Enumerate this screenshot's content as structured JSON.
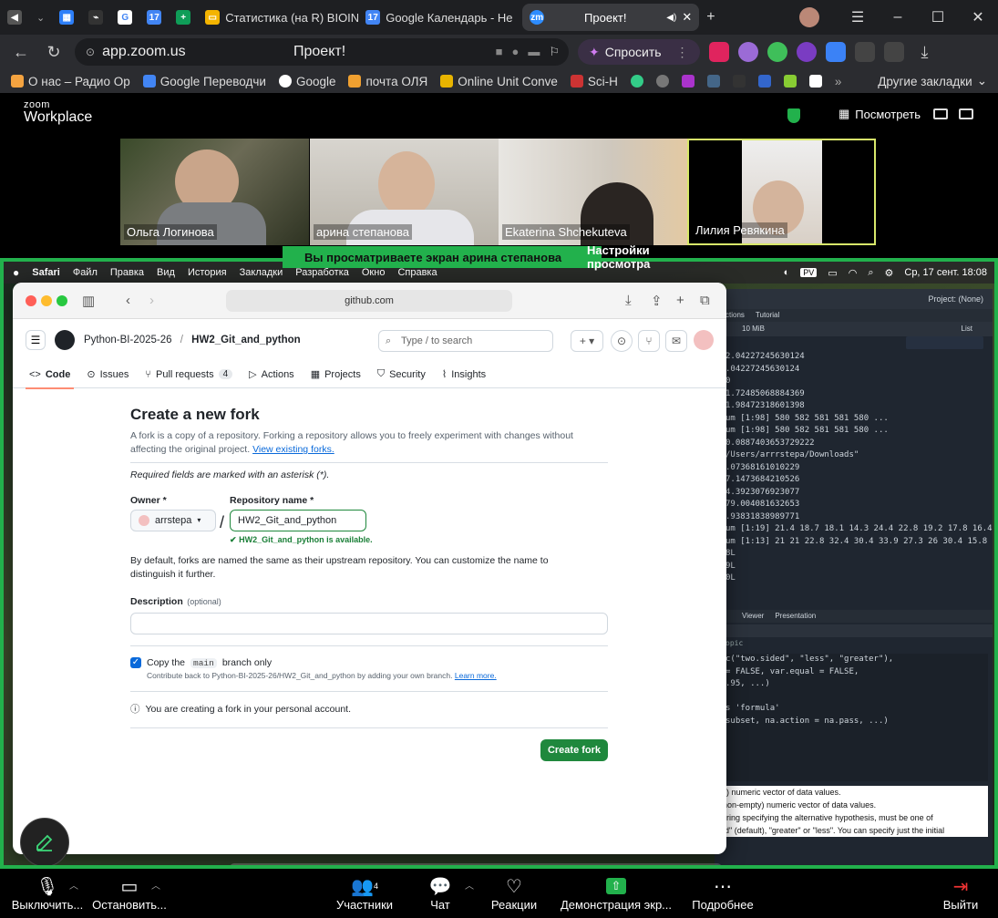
{
  "browser": {
    "tabs": [
      {
        "label": "",
        "icon": "speaker-icon"
      },
      {
        "label": "",
        "icon": "chevron-down-icon"
      },
      {
        "label": "",
        "icon": "grid-icon"
      },
      {
        "label": "",
        "icon": "link-icon"
      },
      {
        "label": "",
        "icon": "google-icon"
      },
      {
        "label": "",
        "icon": "calendar-icon"
      },
      {
        "label": "",
        "icon": "sheets-icon"
      },
      {
        "label": "Статистика (на R) BIOIN",
        "icon": "slides-icon"
      },
      {
        "label": "Google Календарь - Не",
        "icon": "calendar-icon"
      },
      {
        "label": "Проект!",
        "icon": "zoom-icon"
      }
    ],
    "url": "app.zoom.us",
    "page_title": "Проект!",
    "ask_button": "Спросить",
    "bookmarks": [
      "О нас – Радио Ор",
      "Google Переводчи",
      "Google",
      "почта ОЛЯ",
      "Online Unit Conve",
      "Sci-H"
    ],
    "other_bookmarks": "Другие закладки"
  },
  "zoom": {
    "logo_top": "zoom",
    "logo_bottom": "Workplace",
    "view_button": "Посмотреть",
    "participants": [
      {
        "name": "Ольга Логинова"
      },
      {
        "name": "арина степанова"
      },
      {
        "name": "Ekaterina Shchekuteva"
      },
      {
        "name": "Лилия Ревякина"
      }
    ],
    "share_banner": "Вы просматриваете экран  арина степанова",
    "share_settings": "Настройки просмотра",
    "toolbar": {
      "mute": "Выключить...",
      "video": "Остановить...",
      "participants": "Участники",
      "participants_count": "4",
      "chat": "Чат",
      "reactions": "Реакции",
      "share": "Демонстрация экр...",
      "more": "Подробнее",
      "leave": "Выйти"
    }
  },
  "mac": {
    "menu": [
      "Safari",
      "Файл",
      "Правка",
      "Вид",
      "История",
      "Закладки",
      "Разработка",
      "Окно",
      "Справка"
    ],
    "clock": "Ср, 17 сент.  18:08",
    "pv": "PV"
  },
  "safari": {
    "url": "github.com"
  },
  "github": {
    "owner": "Python-BI-2025-26",
    "repo": "HW2_Git_and_python",
    "separator": "/",
    "search_placeholder": "Type / to search",
    "tabs": [
      {
        "label": "Code"
      },
      {
        "label": "Issues"
      },
      {
        "label": "Pull requests",
        "count": "4"
      },
      {
        "label": "Actions"
      },
      {
        "label": "Projects"
      },
      {
        "label": "Security"
      },
      {
        "label": "Insights"
      }
    ],
    "fork": {
      "title": "Create a new fork",
      "intro_1": "A fork is a copy of a repository. Forking a repository allows you to freely experiment with changes without",
      "intro_2": "affecting the original project.",
      "view_link": "View existing forks.",
      "required": "Required fields are marked with an asterisk (*).",
      "owner_label": "Owner *",
      "owner_value": "arrstepa",
      "name_label": "Repository name *",
      "name_value": "HW2_Git_and_python",
      "available": "HW2_Git_and_python is available.",
      "default_note_1": "By default, forks are named the same as their upstream repository. You can customize the name to",
      "default_note_2": "distinguish it further.",
      "description_label": "Description",
      "description_optional": "(optional)",
      "description_value": "",
      "copy_label_pre": "Copy the",
      "copy_branch": "main",
      "copy_label_post": "branch only",
      "copy_checked": true,
      "contribute_note": "Contribute back to Python-BI-2025-26/HW2_Git_and_python by adding your own branch.",
      "learn_more": "Learn more.",
      "info": "You are creating a fork in your personal account.",
      "create_button": "Create fork"
    }
  },
  "rstudio": {
    "project": "Project: (None)",
    "tabs_top": [
      "ctions",
      "Tutorial"
    ],
    "mem": "10 MiB",
    "list": "List",
    "console_lines": [
      "2.04227245630124",
      ".04227245630124",
      "0",
      "1.72485068884369",
      "1.98472318601398",
      "um [1:98] 580 582 581 581 580 ...",
      "um [1:98] 580 582 581 581 580 ...",
      "0.0887403653729222",
      "/Users/arrrstepa/Downloads\"",
      ".07368161010229",
      "7.1473684210526",
      "4.3923076923077",
      "79.004081632653",
      ".93831838989771",
      "um [1:19] 21.4 18.7 18.1 14.3 24.4 22.8 19.2 17.8 16.4 ...",
      "um [1:13] 21 21 22.8 32.4 30.4 33.9 27.3 26 30.4 15.8 ...",
      "8L",
      "9L",
      "0L"
    ],
    "tabs_bottom": [
      "Viewer",
      "Presentation"
    ],
    "topic": "opic",
    "code_lines": [
      "c(\"two.sided\", \"less\", \"greater\"),",
      " = FALSE, var.equal = FALSE,",
      ".95, ...)",
      "",
      "s 'formula'",
      " subset, na.action = na.pass, ...)"
    ],
    "help_lines": [
      "ty) numeric vector of data values.",
      "(non-empty) numeric vector of data values.",
      "string specifying the alternative hypothesis, must be one of",
      "ed\" (default), \"greater\" or \"less\". You can specify just the initial"
    ]
  },
  "colors": {
    "zoom_green": "#22b14c",
    "github_green": "#1f883d",
    "link_blue": "#0969da"
  }
}
